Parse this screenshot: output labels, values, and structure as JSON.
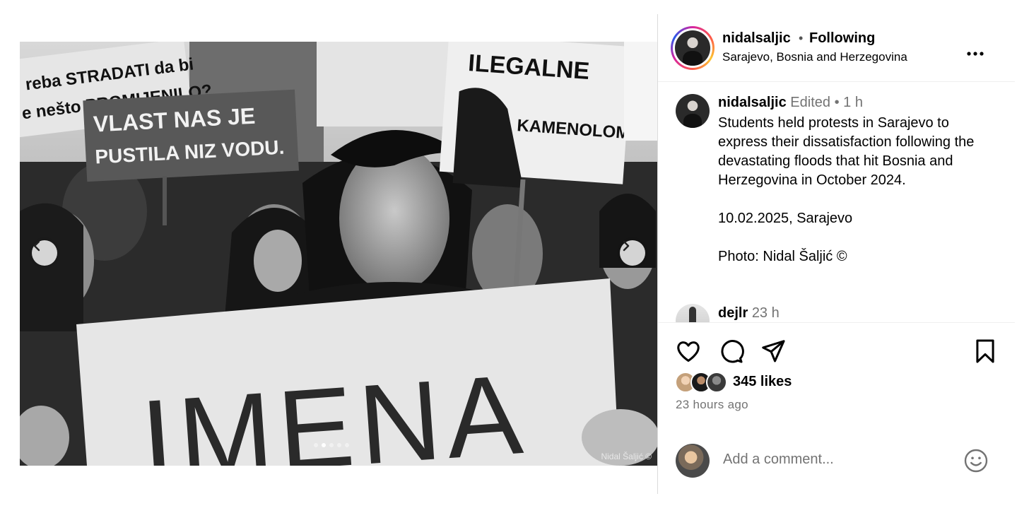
{
  "post": {
    "username": "nidalsaljic",
    "separator": "•",
    "follow_status": "Following",
    "location": "Sarajevo, Bosnia and Herzegovina",
    "more_label": "..."
  },
  "media": {
    "signs": {
      "top_left_line1": "reba STRADATI da bi",
      "top_left_line2": "e nešto PROMIJENILO?",
      "blue_line1": "VLAST NAS JE",
      "blue_line2": "PUSTILA NIZ VODU.",
      "right_line1": "ILEGALNE",
      "right_line2": "KAMENOLOME",
      "front": "IMENA"
    },
    "watermark": "Nidal Šaljić ©",
    "slide_count": 5,
    "active_slide": 1
  },
  "caption": {
    "username": "nidalsaljic",
    "edited": "Edited",
    "dot": "•",
    "time": "1 h",
    "paragraphs": [
      "Students held protests in Sarajevo to express their dissatisfaction following the devastating floods that hit Bosnia and Herzegovina in October 2024.",
      "10.02.2025, Sarajevo",
      "Photo: Nidal Šaljić ©"
    ]
  },
  "comment": {
    "username": "dejlr",
    "time": "23 h"
  },
  "actions": {
    "like_icon": "heart-icon",
    "comment_icon": "speech-bubble-icon",
    "share_icon": "paper-plane-icon",
    "save_icon": "bookmark-icon"
  },
  "stats": {
    "likes": "345 likes",
    "posted": "23 hours ago"
  },
  "add_comment": {
    "placeholder": "Add a comment...",
    "emoji_icon": "smiley-icon"
  }
}
